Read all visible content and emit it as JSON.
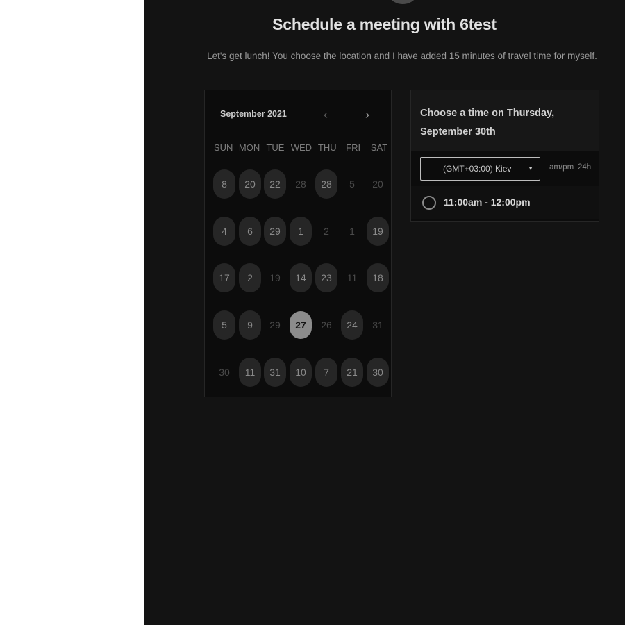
{
  "header": {
    "title": "Schedule a meeting with 6test",
    "subtitle": "Let's get lunch! You choose the location and I have added 15 minutes of travel time for myself."
  },
  "calendar": {
    "month_label": "September 2021",
    "prev_label": "‹",
    "next_label": "›",
    "weekdays": [
      "SUN",
      "MON",
      "TUE",
      "WED",
      "THU",
      "FRI",
      "SAT"
    ],
    "weeks": [
      [
        {
          "n": "8",
          "avail": true
        },
        {
          "n": "20",
          "avail": true
        },
        {
          "n": "22",
          "avail": true
        },
        {
          "n": "28",
          "avail": false
        },
        {
          "n": "28",
          "avail": true
        },
        {
          "n": "5",
          "avail": false
        },
        {
          "n": "20",
          "avail": false
        }
      ],
      [
        {
          "n": "4",
          "avail": true
        },
        {
          "n": "6",
          "avail": true
        },
        {
          "n": "29",
          "avail": true
        },
        {
          "n": "1",
          "avail": true
        },
        {
          "n": "2",
          "avail": false
        },
        {
          "n": "1",
          "avail": false
        },
        {
          "n": "19",
          "avail": true
        }
      ],
      [
        {
          "n": "17",
          "avail": true
        },
        {
          "n": "2",
          "avail": true
        },
        {
          "n": "19",
          "avail": false
        },
        {
          "n": "14",
          "avail": true
        },
        {
          "n": "23",
          "avail": true
        },
        {
          "n": "11",
          "avail": false
        },
        {
          "n": "18",
          "avail": true
        }
      ],
      [
        {
          "n": "5",
          "avail": true
        },
        {
          "n": "9",
          "avail": true
        },
        {
          "n": "29",
          "avail": false
        },
        {
          "n": "27",
          "avail": true,
          "selected": true
        },
        {
          "n": "26",
          "avail": false
        },
        {
          "n": "24",
          "avail": true
        },
        {
          "n": "31",
          "avail": false
        }
      ],
      [
        {
          "n": "30",
          "avail": false
        },
        {
          "n": "11",
          "avail": true
        },
        {
          "n": "31",
          "avail": true
        },
        {
          "n": "10",
          "avail": true
        },
        {
          "n": "7",
          "avail": true
        },
        {
          "n": "21",
          "avail": true
        },
        {
          "n": "30",
          "avail": true
        }
      ]
    ]
  },
  "timepicker": {
    "heading": "Choose a time on Thursday, September 30th",
    "timezone": "(GMT+03:00) Kiev",
    "caret": "▼",
    "format_ampm": "am/pm",
    "format_24h": "24h",
    "slots": [
      "11:00am - 12:00pm"
    ]
  },
  "colors": {
    "panel_bg": "#131313",
    "available_day": "#262626",
    "selected_day": "#8c8c8c"
  }
}
